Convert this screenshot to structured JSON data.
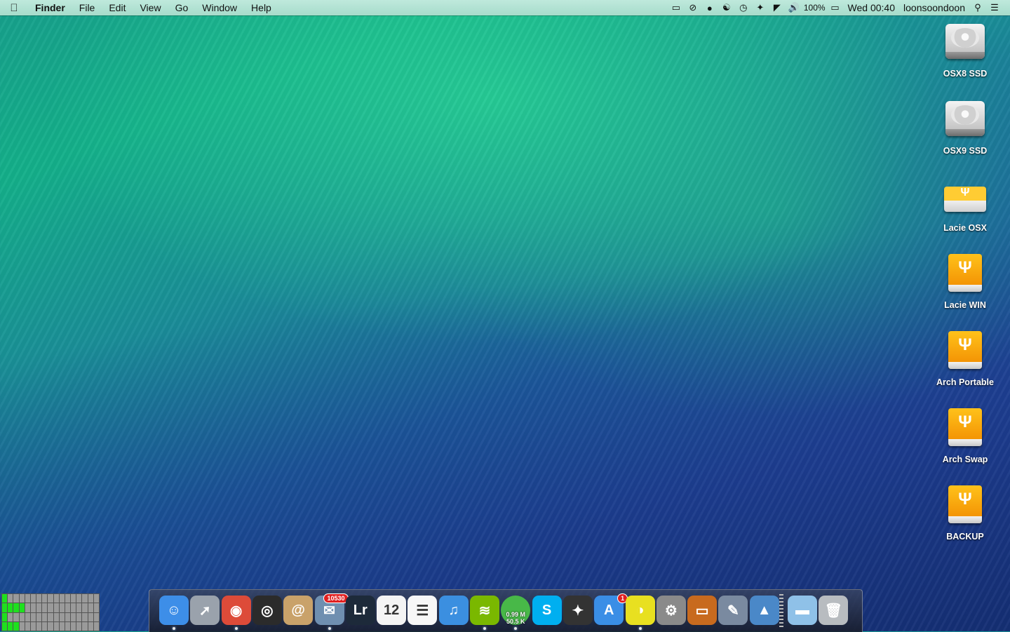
{
  "menubar": {
    "app_name": "Finder",
    "menus": [
      "File",
      "Edit",
      "View",
      "Go",
      "Window",
      "Help"
    ],
    "status_icons": [
      "airplay-icon",
      "do-not-disturb-icon",
      "notification-icon",
      "accessibility-icon",
      "time-machine-icon",
      "bluetooth-icon",
      "wifi-icon",
      "volume-icon"
    ],
    "battery_text": "100%",
    "clock": "Wed 00:40",
    "user": "loonsoondoon"
  },
  "desktop": {
    "drives": [
      {
        "label": "OSX8 SSD",
        "kind": "hdd"
      },
      {
        "label": "OSX9 SSD",
        "kind": "hdd"
      },
      {
        "label": "Lacie OSX",
        "kind": "usb-flat"
      },
      {
        "label": "Lacie WIN",
        "kind": "usb"
      },
      {
        "label": "Arch Portable",
        "kind": "usb"
      },
      {
        "label": "Arch Swap",
        "kind": "usb"
      },
      {
        "label": "BACKUP",
        "kind": "usb"
      }
    ]
  },
  "activity_grid": {
    "rows": 4,
    "cols": 17,
    "active_per_row": [
      1,
      4,
      1,
      3
    ]
  },
  "dock": {
    "apps": [
      {
        "name": "finder",
        "color": "#3d8ee8",
        "glyph": "☺",
        "running": true
      },
      {
        "name": "launchpad",
        "color": "#9aa2ac",
        "glyph": "➚",
        "running": false
      },
      {
        "name": "chrome",
        "color": "#dd4b39",
        "glyph": "◉",
        "running": true
      },
      {
        "name": "aperture",
        "color": "#2b2b2b",
        "glyph": "◎",
        "running": false
      },
      {
        "name": "contacts",
        "color": "#c9a26a",
        "glyph": "@",
        "running": false
      },
      {
        "name": "mail",
        "color": "#6f8fb0",
        "glyph": "✉",
        "running": true,
        "badge": "10530"
      },
      {
        "name": "lightroom",
        "color": "#1d2a3a",
        "glyph": "Lr",
        "running": false
      },
      {
        "name": "calendar",
        "color": "#f4f4f4",
        "glyph": "12",
        "running": false
      },
      {
        "name": "reminders",
        "color": "#f7f7f7",
        "glyph": "☰",
        "running": false
      },
      {
        "name": "itunes",
        "color": "#3b8fe0",
        "glyph": "♫",
        "running": false
      },
      {
        "name": "spotify",
        "color": "#7ab800",
        "glyph": "≋",
        "running": true
      },
      {
        "name": "network-meter",
        "color": "#48b848",
        "running": true,
        "line1": "0.99 M",
        "line2": "50.5 K"
      },
      {
        "name": "skype",
        "color": "#00aff0",
        "glyph": "S",
        "running": false
      },
      {
        "name": "final-cut",
        "color": "#333333",
        "glyph": "✦",
        "running": false
      },
      {
        "name": "app-store",
        "color": "#3a8ee6",
        "glyph": "A",
        "running": false,
        "badge": "1"
      },
      {
        "name": "color-picker",
        "color": "#e8e020",
        "glyph": "◑",
        "running": true
      },
      {
        "name": "system-preferences",
        "color": "#8a8a8a",
        "glyph": "⚙",
        "running": false
      },
      {
        "name": "keynote",
        "color": "#c86a1e",
        "glyph": "▭",
        "running": false
      },
      {
        "name": "script-editor",
        "color": "#7a8aa0",
        "glyph": "✎",
        "running": false
      },
      {
        "name": "grapher",
        "color": "#4a88c8",
        "glyph": "▲",
        "running": false
      },
      {
        "name": "folder",
        "color": "#8fc1e8",
        "glyph": "▬",
        "running": false
      },
      {
        "name": "trash",
        "color": "#b8bcc0",
        "glyph": "🗑",
        "running": false
      }
    ]
  }
}
